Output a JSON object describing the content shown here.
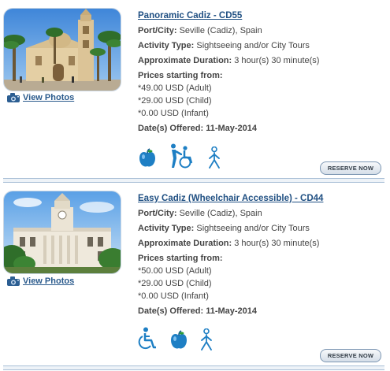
{
  "tours": [
    {
      "title": "Panoramic Cadiz - CD55",
      "port_label": "Port/City:",
      "port_value": "Seville (Cadiz), Spain",
      "activity_label": "Activity Type:",
      "activity_value": "Sightseeing and/or City Tours",
      "duration_label": "Approximate Duration:",
      "duration_value": "3 hour(s) 30 minute(s)",
      "prices_label": "Prices starting from:",
      "prices": [
        "*49.00 USD (Adult)",
        "*29.00 USD (Child)",
        "*0.00 USD (Infant)"
      ],
      "date_label": "Date(s) Offered:",
      "date_value": "11-May-2014",
      "view_photos": "View Photos",
      "reserve": "RESERVE NOW",
      "icons": [
        "apple-icon",
        "wheelchair-assist-icon",
        "walking-icon"
      ]
    },
    {
      "title": "Easy Cadiz (Wheelchair Accessible) - CD44",
      "port_label": "Port/City:",
      "port_value": "Seville (Cadiz), Spain",
      "activity_label": "Activity Type:",
      "activity_value": "Sightseeing and/or City Tours",
      "duration_label": "Approximate Duration:",
      "duration_value": "3 hour(s) 30 minute(s)",
      "prices_label": "Prices starting from:",
      "prices": [
        "*50.00 USD (Adult)",
        "*29.00 USD (Child)",
        "*0.00 USD (Infant)"
      ],
      "date_label": "Date(s) Offered:",
      "date_value": "11-May-2014",
      "view_photos": "View Photos",
      "reserve": "RESERVE NOW",
      "icons": [
        "wheelchair-icon",
        "apple-icon",
        "walking-icon"
      ]
    }
  ],
  "colors": {
    "title_link": "#1f4f82",
    "icon_blue": "#1e7fc4",
    "divider": "#a9bfd6"
  }
}
